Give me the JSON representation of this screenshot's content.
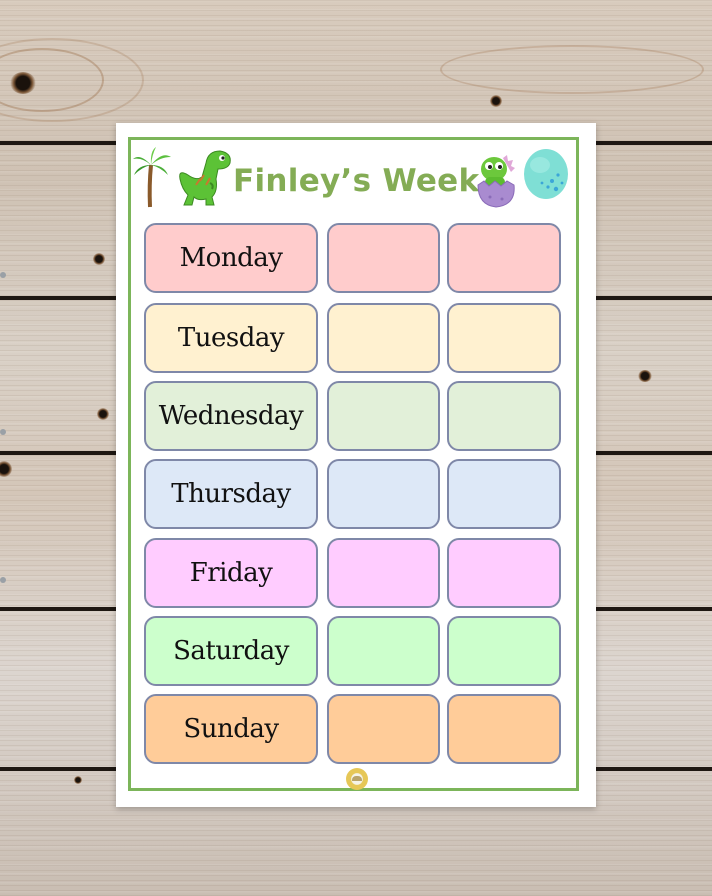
{
  "title": "Finley’s Week",
  "colors": {
    "title": "#84ac55",
    "frame": "#7cb55a",
    "cell_border": "#7f88a8"
  },
  "decorations": {
    "left": [
      "palm-tree",
      "green-dinosaur"
    ],
    "right": [
      "baby-dinosaur-in-purple-egg",
      "teal-spotted-egg"
    ],
    "footer": "round-logo"
  },
  "days": [
    {
      "label": "Monday",
      "color": "#ffcccc"
    },
    {
      "label": "Tuesday",
      "color": "#fff1d0"
    },
    {
      "label": "Wednesday",
      "color": "#e2f0d9"
    },
    {
      "label": "Thursday",
      "color": "#dde8f7"
    },
    {
      "label": "Friday",
      "color": "#ffccff"
    },
    {
      "label": "Saturday",
      "color": "#ccffcc"
    },
    {
      "label": "Sunday",
      "color": "#ffcc99"
    }
  ],
  "extra_columns": 2
}
